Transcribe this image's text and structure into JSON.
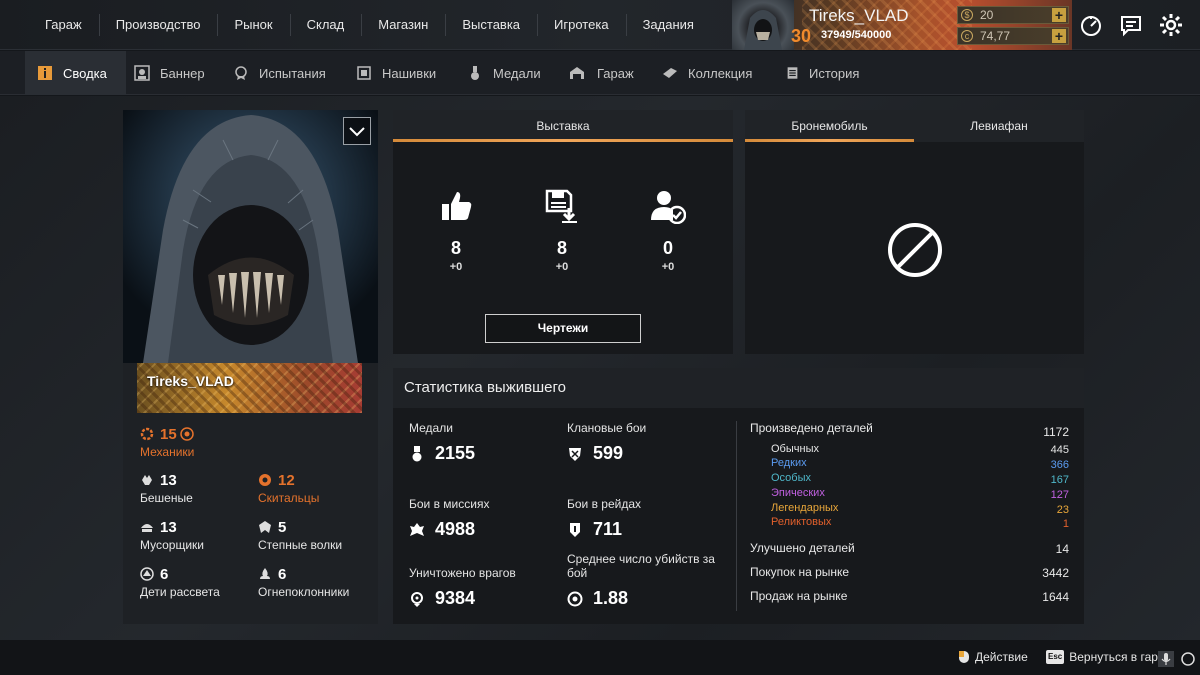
{
  "top_nav": {
    "items": [
      "Гараж",
      "Производство",
      "Рынок",
      "Склад",
      "Магазин",
      "Выставка",
      "Игротека",
      "Задания"
    ]
  },
  "player": {
    "name": "Tireks_VLAD",
    "level": "30",
    "xp": "37949/540000",
    "currency_1": "20",
    "currency_2": "74,77"
  },
  "sub_tabs": {
    "items": [
      "Сводка",
      "Баннер",
      "Испытания",
      "Нашивки",
      "Медали",
      "Гараж",
      "Коллекция",
      "История"
    ],
    "active_index": 0
  },
  "profile": {
    "banner_name": "Tireks_VLAD",
    "factions": [
      {
        "value": "15",
        "label": "Механики",
        "icon": "mechanics-icon",
        "highlight": true
      },
      {
        "value": "13",
        "label": "Бешеные",
        "icon": "lunatics-icon",
        "highlight": false
      },
      {
        "value": "12",
        "label": "Скитальцы",
        "icon": "nomads-icon",
        "highlight": true
      },
      {
        "value": "13",
        "label": "Мусорщики",
        "icon": "scavengers-icon",
        "highlight": false
      },
      {
        "value": "5",
        "label": "Степные волки",
        "icon": "steppenwolfs-icon",
        "highlight": false
      },
      {
        "value": "6",
        "label": "Дети рассвета",
        "icon": "dawns-children-icon",
        "highlight": false
      },
      {
        "value": "6",
        "label": "Огнепоклонники",
        "icon": "firestarters-icon",
        "highlight": false
      }
    ]
  },
  "exhibition": {
    "tab_label": "Выставка",
    "stats": [
      {
        "icon": "like-icon",
        "value": "8",
        "delta": "+0"
      },
      {
        "icon": "download-save-icon",
        "value": "8",
        "delta": "+0"
      },
      {
        "icon": "user-check-icon",
        "value": "0",
        "delta": "+0"
      }
    ],
    "blueprints_label": "Чертежи"
  },
  "vehicles": {
    "tabs": [
      "Бронемобиль",
      "Левиафан"
    ],
    "active_index": 0
  },
  "survivor": {
    "title": "Статистика выжившего",
    "left_stats": [
      {
        "label": "Медали",
        "value": "2155",
        "icon": "medal-icon"
      },
      {
        "label": "Клановые бои",
        "value": "599",
        "icon": "clan-battle-icon"
      },
      {
        "label": "Бои в миссиях",
        "value": "4988",
        "icon": "mission-icon"
      },
      {
        "label": "Бои в рейдах",
        "value": "711",
        "icon": "raid-icon"
      },
      {
        "label": "Уничтожено врагов",
        "value": "9384",
        "icon": "crosshair-icon"
      },
      {
        "label": "Среднее число убийств за бой",
        "value": "1.88",
        "icon": "kill-average-icon"
      }
    ],
    "parts_produced": {
      "label": "Произведено деталей",
      "value": "1172"
    },
    "rarities": [
      {
        "label": "Обычных",
        "value": "445",
        "color": "#e6e6e6"
      },
      {
        "label": "Редких",
        "value": "366",
        "color": "#5b9bf0"
      },
      {
        "label": "Особых",
        "value": "167",
        "color": "#4fb7c9"
      },
      {
        "label": "Эпических",
        "value": "127",
        "color": "#c060e0"
      },
      {
        "label": "Легендарных",
        "value": "23",
        "color": "#e8a63a"
      },
      {
        "label": "Реликтовых",
        "value": "1",
        "color": "#e2602c"
      }
    ],
    "other": [
      {
        "label": "Улучшено деталей",
        "value": "14"
      },
      {
        "label": "Покупок на рынке",
        "value": "3442"
      },
      {
        "label": "Продаж на рынке",
        "value": "1644"
      }
    ]
  },
  "bottom_bar": {
    "action_label": "Действие",
    "esc_key": "Esc",
    "back_label": "Вернуться в гар"
  },
  "colors": {
    "accent_orange": "#e4722c",
    "tab_underline": "#f1a65a"
  }
}
